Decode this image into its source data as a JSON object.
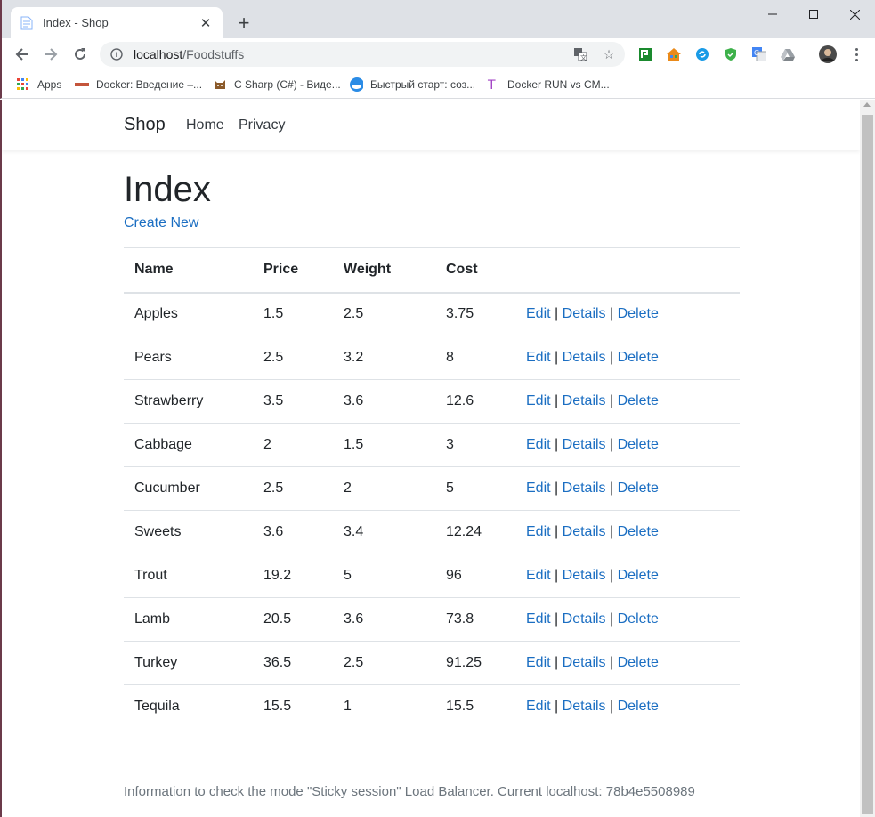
{
  "browser": {
    "tab_title": "Index - Shop",
    "new_tab": "+",
    "url_host": "localhost",
    "url_path": "/Foodstuffs",
    "bookmarks": [
      {
        "label": "Apps",
        "icon": "apps-grid-icon"
      },
      {
        "label": "Docker: Введение –...",
        "icon": "docker-site-icon"
      },
      {
        "label": "C Sharp (C#) - Виде...",
        "icon": "csharp-site-icon"
      },
      {
        "label": "Быстрый старт: соз...",
        "icon": "docker-whale-icon"
      },
      {
        "label": "Docker RUN vs CM...",
        "icon": "t-letter-icon"
      }
    ]
  },
  "site": {
    "brand": "Shop",
    "nav": [
      "Home",
      "Privacy"
    ]
  },
  "page": {
    "title": "Index",
    "create_link": "Create New"
  },
  "table": {
    "headers": [
      "Name",
      "Price",
      "Weight",
      "Cost"
    ],
    "actions": {
      "edit": "Edit",
      "details": "Details",
      "delete": "Delete",
      "separator": "|"
    },
    "rows": [
      [
        "Apples",
        "1.5",
        "2.5",
        "3.75"
      ],
      [
        "Pears",
        "2.5",
        "3.2",
        "8"
      ],
      [
        "Strawberry",
        "3.5",
        "3.6",
        "12.6"
      ],
      [
        "Cabbage",
        "2",
        "1.5",
        "3"
      ],
      [
        "Cucumber",
        "2.5",
        "2",
        "5"
      ],
      [
        "Sweets",
        "3.6",
        "3.4",
        "12.24"
      ],
      [
        "Trout",
        "19.2",
        "5",
        "96"
      ],
      [
        "Lamb",
        "20.5",
        "3.6",
        "73.8"
      ],
      [
        "Turkey",
        "36.5",
        "2.5",
        "91.25"
      ],
      [
        "Tequila",
        "15.5",
        "1",
        "15.5"
      ]
    ]
  },
  "footer": {
    "text": "Information to check the mode \"Sticky session\" Load Balancer. Current localhost: 78b4e5508989"
  },
  "colors": {
    "link": "#1b6ec2",
    "text": "#212529"
  }
}
